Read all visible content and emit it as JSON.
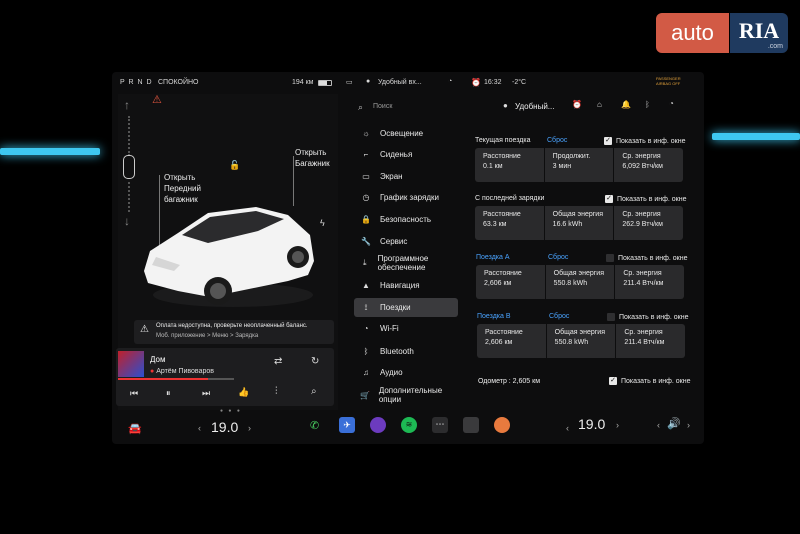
{
  "watermark": {
    "auto": "auto",
    "ria": "RIA",
    "com": ".com"
  },
  "status_bar": {
    "gear": "P R N D",
    "ready": "СПОКОЙНО",
    "range": "194 км",
    "profile": "Удобный вх...",
    "time": "16:32",
    "temp": "-2°C",
    "passenger_airbag": "PASSENGER AIRBAG OFF"
  },
  "car_panel": {
    "frunk_label": "Открыть Передний багажник",
    "trunk_label": "Открыть Багажник",
    "warning_title": "Оплата недоступна, проверьте неоплаченный баланс.",
    "warning_sub": "Моб. приложение > Меню > Зарядка"
  },
  "media": {
    "title": "Дом",
    "artist": "Артём Пивоваров",
    "progress": 0.78
  },
  "search": {
    "placeholder": "Поиск"
  },
  "profile_short": "Удобный...",
  "menu": [
    {
      "label": "Освещение",
      "icon": "light-icon"
    },
    {
      "label": "Сиденья",
      "icon": "seat-icon"
    },
    {
      "label": "Экран",
      "icon": "screen-icon"
    },
    {
      "label": "График зарядки",
      "icon": "clock-icon"
    },
    {
      "label": "Безопасность",
      "icon": "lock-icon"
    },
    {
      "label": "Сервис",
      "icon": "wrench-icon"
    },
    {
      "label": "Программное обеспечение",
      "icon": "download-icon"
    },
    {
      "label": "Навигация",
      "icon": "nav-icon"
    },
    {
      "label": "Поездки",
      "icon": "trips-icon"
    },
    {
      "label": "Wi-Fi",
      "icon": "wifi-icon"
    },
    {
      "label": "Bluetooth",
      "icon": "bluetooth-icon"
    },
    {
      "label": "Аудио",
      "icon": "audio-icon"
    },
    {
      "label": "Дополнительные опции",
      "icon": "cart-icon"
    }
  ],
  "trips": {
    "current": {
      "title": "Текущая поездка",
      "reset": "Сброс",
      "show": "Показать в инф. окне",
      "cells": [
        [
          "Расстояние",
          "0.1 км"
        ],
        [
          "Продолжит.",
          "3 мин"
        ],
        [
          "Ср. энергия",
          "6,092 Втч/км"
        ]
      ]
    },
    "since_charge": {
      "title": "С последней зарядки",
      "show": "Показать в инф. окне",
      "cells": [
        [
          "Расстояние",
          "63.3 км"
        ],
        [
          "Общая энергия",
          "16.6 kWh"
        ],
        [
          "Ср. энергия",
          "262.9 Втч/км"
        ]
      ]
    },
    "trip_a": {
      "title": "Поездка A",
      "reset": "Сброс",
      "show": "Показать в инф. окне",
      "cells": [
        [
          "Расстояние",
          "2,606 км"
        ],
        [
          "Общая энергия",
          "550.8 kWh"
        ],
        [
          "Ср. энергия",
          "211.4 Втч/км"
        ]
      ]
    },
    "trip_b": {
      "title": "Поездка B",
      "reset": "Сброс",
      "show": "Показать в инф. окне",
      "cells": [
        [
          "Расстояние",
          "2,606 км"
        ],
        [
          "Общая энергия",
          "550.8 kWh"
        ],
        [
          "Ср. энергия",
          "211.4 Втч/км"
        ]
      ]
    },
    "odometer": "Одометр : 2,605 км",
    "odometer_show": "Показать в инф. окне"
  },
  "bottom": {
    "temp_left": "19.0",
    "temp_right": "19.0"
  }
}
